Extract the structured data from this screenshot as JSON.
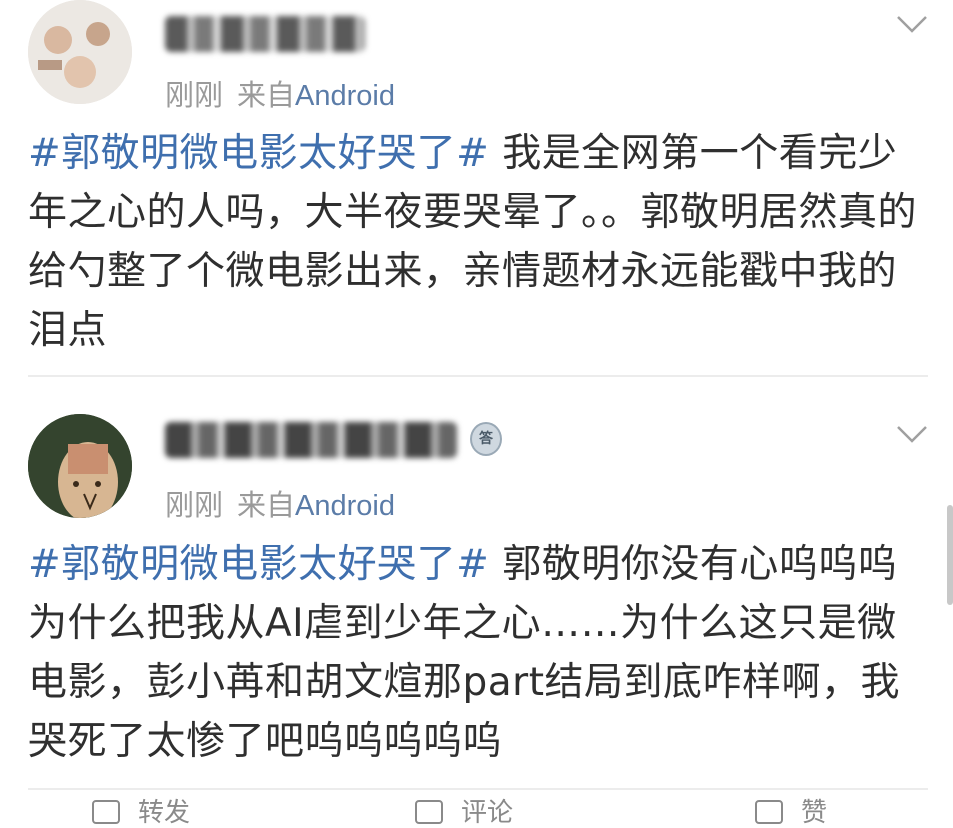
{
  "posts": [
    {
      "avatar_icon": "user-avatar-icon",
      "timestamp": "刚刚",
      "source_prefix": "来自",
      "source": "Android",
      "hashtag": "#郭敬明微电影太好哭了#",
      "text": " 我是全网第一个看完少年之心的人吗，大半夜要哭晕了。。郭敬明居然真的给勺整了个微电影出来，亲情题材永远能戳中我的泪点"
    },
    {
      "avatar_icon": "user-avatar-icon",
      "badge_text": "答",
      "timestamp": "刚刚",
      "source_prefix": "来自",
      "source": "Android",
      "hashtag": "#郭敬明微电影太好哭了#",
      "text": " 郭敬明你没有心呜呜呜为什么把我从AI虐到少年之心……为什么这只是微电影，彭小苒和胡文煊那part结局到底咋样啊，我哭死了太惨了吧呜呜呜呜呜"
    }
  ],
  "actions": {
    "repost": "转发",
    "comment": "评论",
    "like": "赞"
  },
  "colors": {
    "hashtag": "#3f6fae",
    "source": "#5b7ca8",
    "meta": "#9a9a9a",
    "text": "#2f2f2f"
  }
}
